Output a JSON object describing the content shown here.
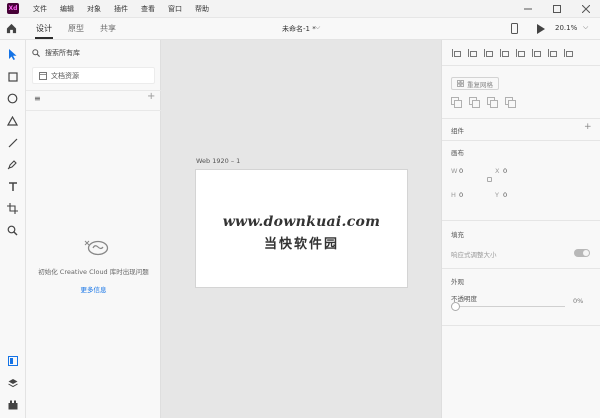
{
  "app": {
    "logo_text": "Xd",
    "menu": [
      "文件",
      "编辑",
      "对象",
      "插件",
      "查看",
      "窗口",
      "帮助"
    ]
  },
  "header": {
    "tabs": [
      "设计",
      "原型",
      "共享"
    ],
    "active_tab": "设计",
    "document_title": "未命名-1 *",
    "zoom": "20.1%"
  },
  "libraries": {
    "search_placeholder": "搜索所有库",
    "document_assets": "文档资源",
    "cc_message": "初始化 Creative Cloud 库时出现问题",
    "more_info": "更多信息"
  },
  "canvas": {
    "artboard_label": "Web 1920 – 1",
    "watermark_url": "www.downkuai.com",
    "watermark_name": "当快软件园"
  },
  "inspector": {
    "repeat_grid": "重复网格",
    "components_label": "组件",
    "canvas_label": "画布",
    "w_label": "W",
    "w_value": "0",
    "x_label": "X",
    "x_value": "0",
    "h_label": "H",
    "h_value": "0",
    "y_label": "Y",
    "y_value": "0",
    "layout_label": "填充",
    "responsive_label": "响应式调整大小",
    "appearance_label": "外观",
    "opacity_label": "不透明度",
    "opacity_value": "0%"
  },
  "colors": {
    "accent_link": "#1473e6",
    "logo_bg": "#470137",
    "canvas_bg": "#e6e6e6"
  }
}
